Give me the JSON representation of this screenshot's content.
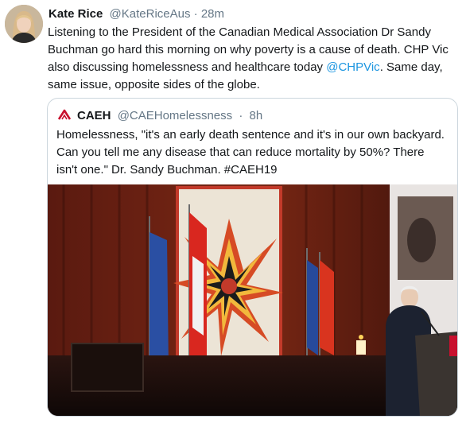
{
  "tweet": {
    "display_name": "Kate Rice",
    "handle": "@KateRiceAus",
    "separator": "·",
    "time": "28m",
    "text_part1": "Listening to the President of the Canadian Medical Association Dr Sandy Buchman go hard this morning on why poverty is a cause of death. CHP Vic also discussing homelessness and healthcare today ",
    "mention": "@CHPVic",
    "text_part2": ". Same day, same issue, opposite sides of the globe."
  },
  "quoted_tweet": {
    "display_name": "CAEH",
    "handle": "@CAEHomelessness",
    "separator": "·",
    "time": "8h",
    "text": "Homelessness, \"it's an early death sentence and it's in our own backyard. Can you tell me any disease that can reduce mortality by 50%? There isn't one.\" Dr. Sandy Buchman. #CAEH19",
    "photo_icon": "conference-photo"
  },
  "colors": {
    "link": "#1b95e0",
    "secondary_text": "#657786",
    "border": "#ccd6dd",
    "caeh_red": "#c8102e"
  }
}
